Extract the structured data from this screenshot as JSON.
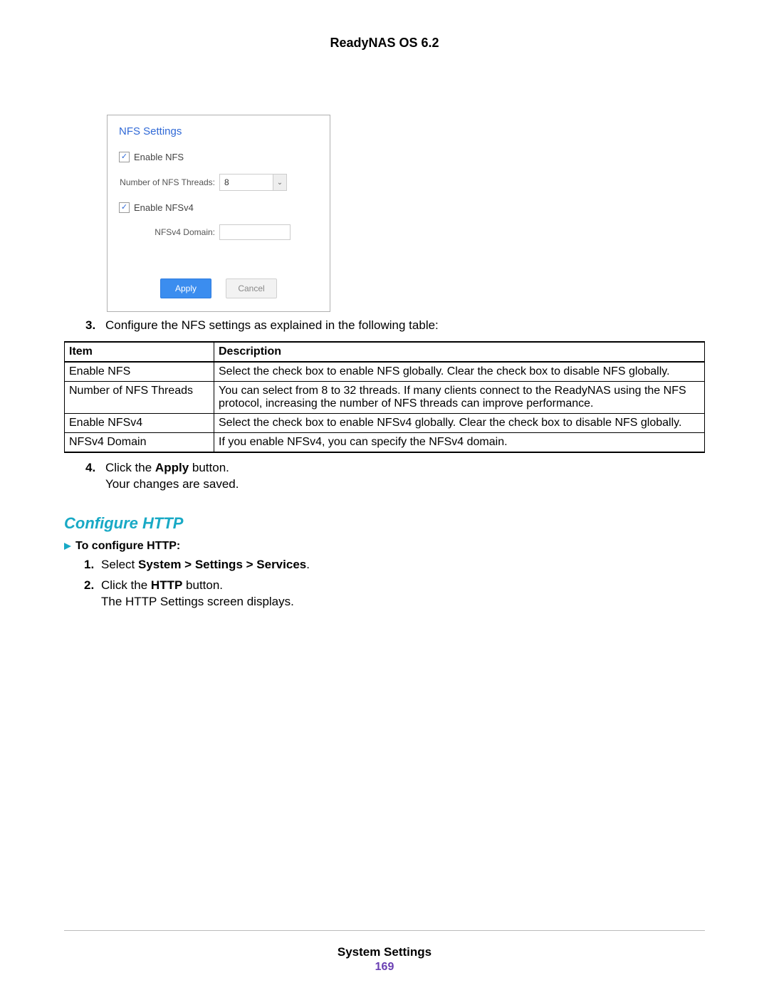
{
  "doc_title": "ReadyNAS OS 6.2",
  "dialog": {
    "title": "NFS Settings",
    "enable_nfs_label": "Enable NFS",
    "threads_label": "Number of NFS Threads:",
    "threads_value": "8",
    "enable_nfsv4_label": "Enable NFSv4",
    "domain_label": "NFSv4 Domain:",
    "domain_value": "",
    "apply_label": "Apply",
    "cancel_label": "Cancel"
  },
  "step3": {
    "num": "3.",
    "text": "Configure the NFS settings as explained in the following table:"
  },
  "table": {
    "header_item": "Item",
    "header_desc": "Description",
    "rows": [
      {
        "item": "Enable NFS",
        "desc": "Select the check box to enable NFS globally. Clear the check box to disable NFS globally."
      },
      {
        "item": "Number of NFS Threads",
        "desc": "You can select from 8 to 32 threads. If many clients connect to the ReadyNAS using the NFS protocol, increasing the number of NFS threads can improve performance."
      },
      {
        "item": "Enable NFSv4",
        "desc": "Select the check box to enable NFSv4 globally. Clear the check box to disable NFS globally."
      },
      {
        "item": "NFSv4 Domain",
        "desc": "If you enable NFSv4, you can specify the NFSv4 domain."
      }
    ]
  },
  "step4": {
    "num": "4.",
    "line1_prefix": "Click the ",
    "line1_bold": "Apply",
    "line1_suffix": " button.",
    "line2": "Your changes are saved."
  },
  "section_heading": "Configure HTTP",
  "sub_proc_label": "To configure HTTP:",
  "http_steps": {
    "s1": {
      "num": "1.",
      "prefix": "Select ",
      "bold": "System > Settings > Services",
      "suffix": "."
    },
    "s2": {
      "num": "2.",
      "prefix": "Click the ",
      "bold": "HTTP",
      "suffix": " button."
    },
    "s2b": "The HTTP Settings screen displays."
  },
  "footer": {
    "section": "System Settings",
    "page": "169"
  }
}
